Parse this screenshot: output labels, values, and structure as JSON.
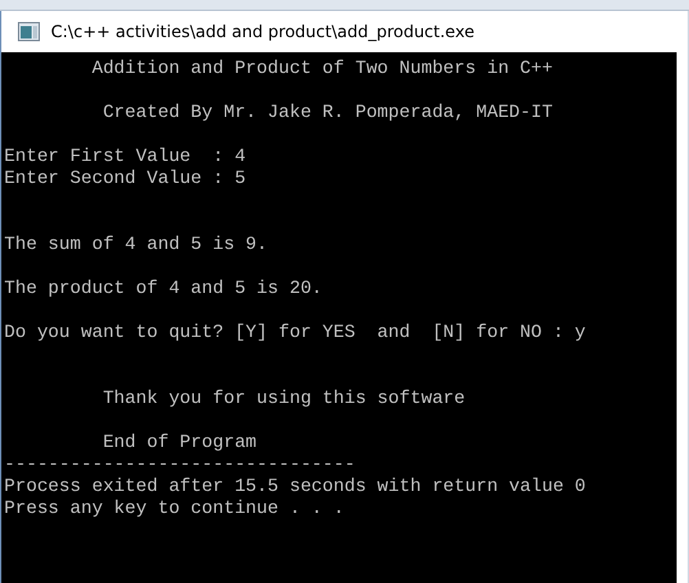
{
  "window": {
    "title": "C:\\c++ activities\\add and product\\add_product.exe"
  },
  "console": {
    "output": "        Addition and Product of Two Numbers in C++\n\n         Created By Mr. Jake R. Pomperada, MAED-IT\n\nEnter First Value  : 4\nEnter Second Value : 5\n\n\nThe sum of 4 and 5 is 9.\n\nThe product of 4 and 5 is 20.\n\nDo you want to quit? [Y] for YES  and  [N] for NO : y\n\n\n         Thank you for using this software\n\n         End of Program\n--------------------------------\nProcess exited after 15.5 seconds with return value 0\nPress any key to continue . . ."
  }
}
